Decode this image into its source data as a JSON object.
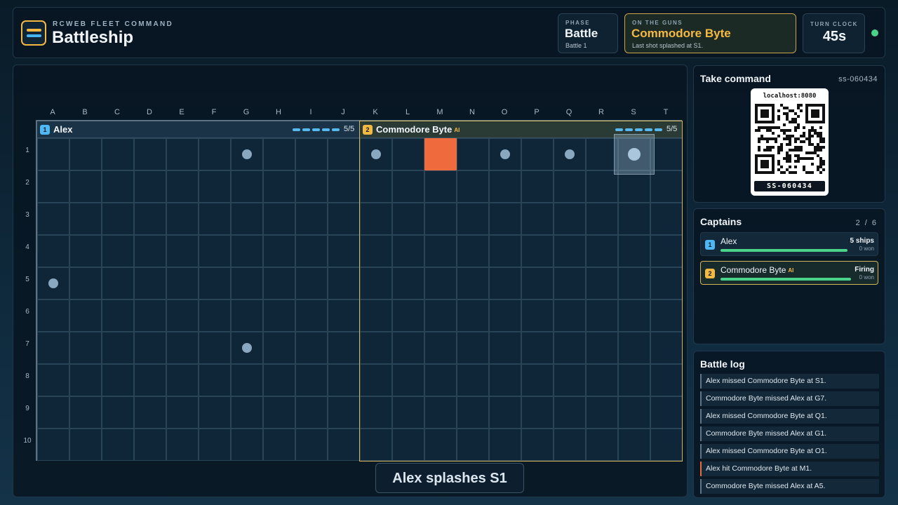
{
  "header": {
    "brand_sub": "RCWEB FLEET COMMAND",
    "title": "Battleship",
    "phase": {
      "caption": "PHASE",
      "value": "Battle",
      "detail": "Battle 1"
    },
    "on_guns": {
      "caption": "ON THE GUNS",
      "value": "Commodore Byte",
      "detail": "Last shot splashed at S1."
    },
    "clock": {
      "caption": "TURN CLOCK",
      "value": "45s"
    },
    "status_color": "#4cd38a"
  },
  "board": {
    "columns": [
      "A",
      "B",
      "C",
      "D",
      "E",
      "F",
      "G",
      "H",
      "I",
      "J",
      "K",
      "L",
      "M",
      "N",
      "O",
      "P",
      "Q",
      "R",
      "S",
      "T"
    ],
    "rows": [
      "1",
      "2",
      "3",
      "4",
      "5",
      "6",
      "7",
      "8",
      "9",
      "10"
    ],
    "left_fleet": {
      "badge": "1",
      "name": "Alex",
      "ai": "",
      "ships": 5,
      "ships_label": "5/5",
      "color": "#4db8f3"
    },
    "right_fleet": {
      "badge": "2",
      "name": "Commodore Byte",
      "ai": "AI",
      "ships": 5,
      "ships_label": "5/5",
      "color": "#f5b942"
    },
    "misses": [
      "G1",
      "K1",
      "O1",
      "Q1",
      "A5",
      "G7"
    ],
    "hits": [
      "M1"
    ],
    "last_shot": "S1",
    "toast": "Alex splashes S1"
  },
  "qr": {
    "title": "Take command",
    "session": "ss-060434",
    "url": "localhost:8080",
    "code": "SS-060434"
  },
  "captains": {
    "title": "Captains",
    "count": "2 / 6",
    "list": [
      {
        "badge": "1",
        "name": "Alex",
        "ai": "",
        "status": "5 ships",
        "won": "0 won",
        "progress": 1.0,
        "color": "#4db8f3",
        "active": false
      },
      {
        "badge": "2",
        "name": "Commodore Byte",
        "ai": "AI",
        "status": "Firing",
        "won": "0 won",
        "progress": 1.0,
        "color": "#f5b942",
        "active": true
      }
    ]
  },
  "log": {
    "title": "Battle log",
    "entries": [
      {
        "text": "Alex missed Commodore Byte at S1.",
        "kind": "miss"
      },
      {
        "text": "Commodore Byte missed Alex at G7.",
        "kind": "miss"
      },
      {
        "text": "Alex missed Commodore Byte at Q1.",
        "kind": "miss"
      },
      {
        "text": "Commodore Byte missed Alex at G1.",
        "kind": "miss"
      },
      {
        "text": "Alex missed Commodore Byte at O1.",
        "kind": "miss"
      },
      {
        "text": "Alex hit Commodore Byte at M1.",
        "kind": "hit"
      },
      {
        "text": "Commodore Byte missed Alex at A5.",
        "kind": "miss"
      }
    ]
  }
}
